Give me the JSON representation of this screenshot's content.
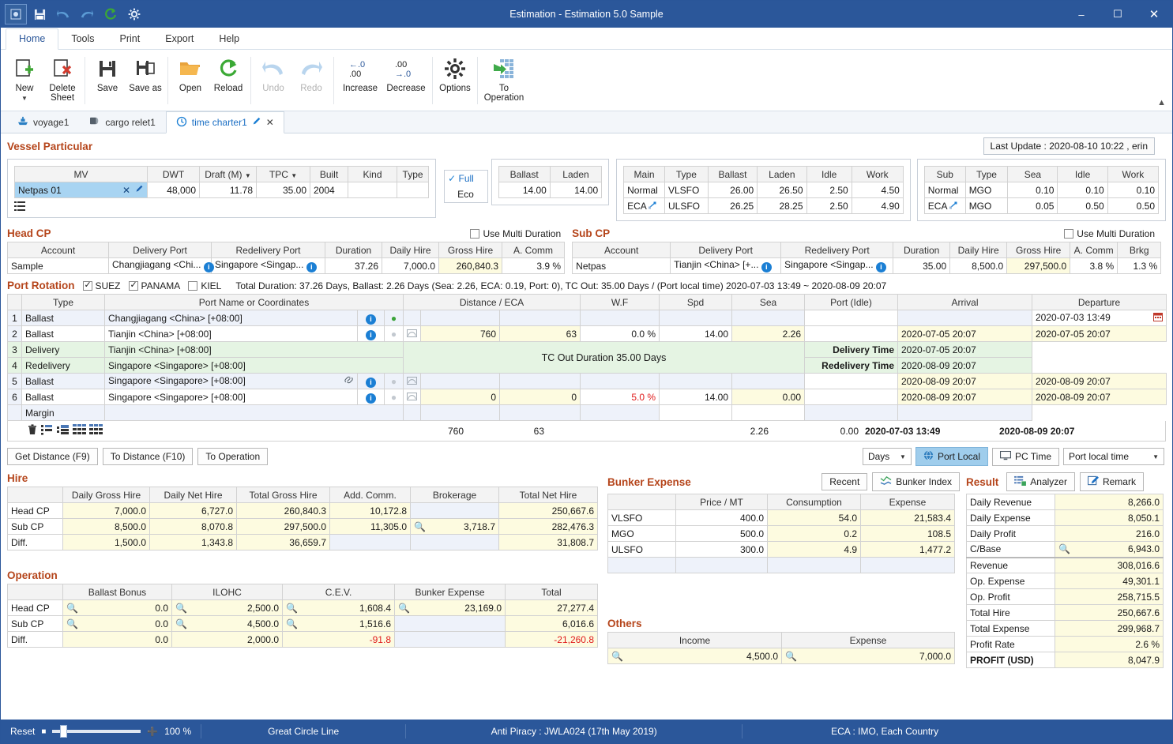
{
  "window": {
    "title": "Estimation - Estimation 5.0 Sample",
    "minimize": "–",
    "maximize": "☐",
    "close": "✕"
  },
  "quick_access": [
    "settings-icon",
    "save-icon",
    "undo-icon",
    "redo-icon",
    "reload-icon",
    "gear-icon"
  ],
  "menu": {
    "tabs": [
      "Home",
      "Tools",
      "Print",
      "Export",
      "Help"
    ],
    "active": "Home"
  },
  "ribbon": {
    "buttons": [
      {
        "label": "New",
        "icon": "new-sheet-icon",
        "has_caret": true,
        "disabled": false
      },
      {
        "label": "Delete Sheet",
        "icon": "delete-sheet-icon",
        "has_caret": false,
        "disabled": false
      },
      {
        "label": "Save",
        "icon": "save-icon",
        "has_caret": false,
        "disabled": false
      },
      {
        "label": "Save as",
        "icon": "save-as-icon",
        "has_caret": false,
        "disabled": false
      },
      {
        "label": "Open",
        "icon": "open-folder-icon",
        "has_caret": false,
        "disabled": false
      },
      {
        "label": "Reload",
        "icon": "reload-icon",
        "has_caret": false,
        "disabled": false
      },
      {
        "label": "Undo",
        "icon": "undo-icon",
        "has_caret": false,
        "disabled": true
      },
      {
        "label": "Redo",
        "icon": "redo-icon",
        "has_caret": false,
        "disabled": true
      },
      {
        "label": "Increase",
        "icon": "increase-decimal-icon",
        "has_caret": false,
        "disabled": false
      },
      {
        "label": "Decrease",
        "icon": "decrease-decimal-icon",
        "has_caret": false,
        "disabled": false
      },
      {
        "label": "Options",
        "icon": "gear-icon",
        "has_caret": false,
        "disabled": false
      },
      {
        "label": "To Operation",
        "icon": "to-operation-icon",
        "has_caret": false,
        "disabled": false
      }
    ]
  },
  "doc_tabs": [
    {
      "label": "voyage1",
      "icon": "ship-icon",
      "active": false
    },
    {
      "label": "cargo relet1",
      "icon": "cargo-icon",
      "active": false
    },
    {
      "label": "time charter1",
      "icon": "clock-icon",
      "active": true
    }
  ],
  "last_update": "Last Update : 2020-08-10 10:22 , erin",
  "vessel_particular": {
    "title": "Vessel Particular",
    "columns": [
      "MV",
      "DWT",
      "Draft (M)",
      "TPC",
      "Built",
      "Kind",
      "Type"
    ],
    "row": {
      "mv": "Netpas 01",
      "dwt": "48,000",
      "draft": "11.78",
      "tpc": "35.00",
      "built": "2004",
      "kind": "",
      "type": ""
    },
    "speed_modes": [
      "Full",
      "Eco"
    ],
    "speed_mode_selected": "Full",
    "speed_columns": [
      "Ballast",
      "Laden"
    ],
    "speed_values": [
      "14.00",
      "14.00"
    ],
    "main_consumption": {
      "columns": [
        "Main",
        "Type",
        "Ballast",
        "Laden",
        "Idle",
        "Work"
      ],
      "rows": [
        {
          "mode": "Normal",
          "type": "VLSFO",
          "ballast": "26.00",
          "laden": "26.50",
          "idle": "2.50",
          "work": "4.50"
        },
        {
          "mode": "ECA",
          "type": "ULSFO",
          "ballast": "26.25",
          "laden": "28.25",
          "idle": "2.50",
          "work": "4.90"
        }
      ]
    },
    "sub_consumption": {
      "columns": [
        "Sub",
        "Type",
        "Sea",
        "Idle",
        "Work"
      ],
      "rows": [
        {
          "mode": "Normal",
          "type": "MGO",
          "sea": "0.10",
          "idle": "0.10",
          "work": "0.10"
        },
        {
          "mode": "ECA",
          "type": "MGO",
          "sea": "0.05",
          "idle": "0.50",
          "work": "0.50"
        }
      ]
    }
  },
  "head_cp": {
    "title": "Head CP",
    "multi_duration_label": "Use Multi Duration",
    "multi_duration_checked": false,
    "columns": [
      "Account",
      "Delivery Port",
      "Redelivery Port",
      "Duration",
      "Daily Hire",
      "Gross Hire",
      "A. Comm"
    ],
    "row": {
      "account": "Sample",
      "delivery_port": "Changjiagang <Chi...",
      "redelivery_port": "Singapore <Singap...",
      "duration": "37.26",
      "daily_hire": "7,000.0",
      "gross_hire": "260,840.3",
      "a_comm": "3.9 %"
    }
  },
  "sub_cp": {
    "title": "Sub CP",
    "multi_duration_label": "Use Multi Duration",
    "multi_duration_checked": false,
    "columns": [
      "Account",
      "Delivery Port",
      "Redelivery Port",
      "Duration",
      "Daily Hire",
      "Gross Hire",
      "A. Comm",
      "Brkg"
    ],
    "row": {
      "account": "Netpas",
      "delivery_port": "Tianjin <China> [+...",
      "redelivery_port": "Singapore <Singap...",
      "duration": "35.00",
      "daily_hire": "8,500.0",
      "gross_hire": "297,500.0",
      "a_comm": "3.8 %",
      "brkg": "1.3 %"
    }
  },
  "port_rotation": {
    "title": "Port Rotation",
    "canals": [
      {
        "label": "SUEZ",
        "checked": true
      },
      {
        "label": "PANAMA",
        "checked": true
      },
      {
        "label": "KIEL",
        "checked": false
      }
    ],
    "summary": "Total Duration: 37.26 Days, Ballast: 2.26 Days (Sea: 2.26, ECA: 0.19, Port: 0), TC Out: 35.00 Days / (Port local time) 2020-07-03 13:49 ~ 2020-08-09 20:07",
    "columns": [
      "",
      "Type",
      "Port Name or Coordinates",
      "Distance / ECA",
      "W.F",
      "Spd",
      "Sea",
      "Port (Idle)",
      "Arrival",
      "Departure"
    ],
    "rows": [
      {
        "no": "1",
        "type": "Ballast",
        "port": "Changjiagang <China> [+08:00]",
        "distance": "",
        "eca": "",
        "wf": "",
        "spd": "",
        "sea": "",
        "idle": "",
        "arrival": "",
        "departure": "2020-07-03 13:49",
        "style": "blu",
        "pin": "on",
        "calendar": true
      },
      {
        "no": "2",
        "type": "Ballast",
        "port": "Tianjin <China> [+08:00]",
        "distance": "760",
        "eca": "63",
        "wf": "0.0 %",
        "spd": "14.00",
        "sea": "2.26",
        "idle": "",
        "arrival": "2020-07-05 20:07",
        "departure": "2020-07-05 20:07",
        "style": "yel",
        "pin": "off",
        "calendar": false
      },
      {
        "no": "5",
        "type": "Ballast",
        "port": "Singapore <Singapore> [+08:00]",
        "distance": "",
        "eca": "",
        "wf": "",
        "spd": "",
        "sea": "",
        "idle": "",
        "arrival": "2020-08-09 20:07",
        "departure": "2020-08-09 20:07",
        "style": "blu",
        "pin": "off",
        "calendar": false,
        "link": true
      },
      {
        "no": "6",
        "type": "Ballast",
        "port": "Singapore <Singapore> [+08:00]",
        "distance": "0",
        "eca": "0",
        "wf": "5.0 %",
        "spd": "14.00",
        "sea": "0.00",
        "idle": "",
        "arrival": "2020-08-09 20:07",
        "departure": "2020-08-09 20:07",
        "style": "yel",
        "pin": "off",
        "calendar": false,
        "wf_red": true
      }
    ],
    "tc_rows": [
      {
        "no": "3",
        "type": "Delivery",
        "port": "Tianjin <China> [+08:00]",
        "time_label": "Delivery Time",
        "time_value": "2020-07-05 20:07"
      },
      {
        "no": "4",
        "type": "Redelivery",
        "port": "Singapore <Singapore> [+08:00]",
        "time_label": "Redelivery Time",
        "time_value": "2020-08-09 20:07"
      }
    ],
    "tc_banner": "TC Out Duration 35.00 Days",
    "margin_label": "Margin",
    "totals": {
      "distance": "760",
      "eca": "63",
      "sea": "2.26",
      "idle": "0.00",
      "arrival": "2020-07-03 13:49",
      "departure": "2020-08-09 20:07"
    },
    "row_tools": [
      "delete-row-icon",
      "insert-row-icon",
      "add-row-icon",
      "split-row-icon",
      "merge-row-icon"
    ]
  },
  "toolbar2": {
    "get_distance": "Get Distance (F9)",
    "to_distance": "To Distance (F10)",
    "to_operation": "To Operation",
    "unit_select": "Days",
    "port_local": "Port Local",
    "pc_time": "PC Time",
    "time_select": "Port local time"
  },
  "hire": {
    "title": "Hire",
    "columns": [
      "",
      "Daily Gross Hire",
      "Daily Net Hire",
      "Total Gross Hire",
      "Add. Comm.",
      "Brokerage",
      "Total Net Hire"
    ],
    "rows": [
      {
        "label": "Head CP",
        "daily_gross": "7,000.0",
        "daily_net": "6,727.0",
        "total_gross": "260,840.3",
        "add_comm": "10,172.8",
        "brokerage": "",
        "total_net": "250,667.6",
        "brokerage_mag": false
      },
      {
        "label": "Sub CP",
        "daily_gross": "8,500.0",
        "daily_net": "8,070.8",
        "total_gross": "297,500.0",
        "add_comm": "11,305.0",
        "brokerage": "3,718.7",
        "total_net": "282,476.3",
        "brokerage_mag": true
      },
      {
        "label": "Diff.",
        "daily_gross": "1,500.0",
        "daily_net": "1,343.8",
        "total_gross": "36,659.7",
        "add_comm": "",
        "brokerage": "",
        "total_net": "31,808.7",
        "brokerage_mag": false
      }
    ]
  },
  "operation": {
    "title": "Operation",
    "columns": [
      "",
      "Ballast Bonus",
      "ILOHC",
      "C.E.V.",
      "Bunker Expense",
      "Total"
    ],
    "rows": [
      {
        "label": "Head CP",
        "ballast_bonus": "0.0",
        "ilohc": "2,500.0",
        "cev": "1,608.4",
        "bunker": "23,169.0",
        "total": "27,277.4",
        "mag": true,
        "bunker_mag": true,
        "cev_red": false,
        "total_red": false
      },
      {
        "label": "Sub CP",
        "ballast_bonus": "0.0",
        "ilohc": "4,500.0",
        "cev": "1,516.6",
        "bunker": "",
        "total": "6,016.6",
        "mag": true,
        "bunker_mag": false,
        "cev_red": false,
        "total_red": false
      },
      {
        "label": "Diff.",
        "ballast_bonus": "0.0",
        "ilohc": "2,000.0",
        "cev": "-91.8",
        "bunker": "",
        "total": "-21,260.8",
        "mag": false,
        "bunker_mag": false,
        "cev_red": true,
        "total_red": true
      }
    ]
  },
  "bunker_expense": {
    "title": "Bunker Expense",
    "recent_button": "Recent",
    "index_button": "Bunker Index",
    "columns": [
      "",
      "Price / MT",
      "Consumption",
      "Expense"
    ],
    "rows": [
      {
        "fuel": "VLSFO",
        "price": "400.0",
        "consumption": "54.0",
        "expense": "21,583.4"
      },
      {
        "fuel": "MGO",
        "price": "500.0",
        "consumption": "0.2",
        "expense": "108.5"
      },
      {
        "fuel": "ULSFO",
        "price": "300.0",
        "consumption": "4.9",
        "expense": "1,477.2"
      },
      {
        "fuel": "",
        "price": "",
        "consumption": "",
        "expense": ""
      }
    ]
  },
  "others": {
    "title": "Others",
    "columns": [
      "Income",
      "Expense"
    ],
    "income": "4,500.0",
    "expense": "7,000.0"
  },
  "result": {
    "title": "Result",
    "analyzer_button": "Analyzer",
    "remark_button": "Remark",
    "rows": [
      {
        "label": "Daily Revenue",
        "value": "8,266.0",
        "mag": false,
        "bold": false
      },
      {
        "label": "Daily Expense",
        "value": "8,050.1",
        "mag": false,
        "bold": false
      },
      {
        "label": "Daily Profit",
        "value": "216.0",
        "mag": false,
        "bold": false
      },
      {
        "label": "C/Base",
        "value": "6,943.0",
        "mag": true,
        "bold": false
      },
      {
        "label": "Revenue",
        "value": "308,016.6",
        "mag": false,
        "bold": false
      },
      {
        "label": "Op. Expense",
        "value": "49,301.1",
        "mag": false,
        "bold": false
      },
      {
        "label": "Op. Profit",
        "value": "258,715.5",
        "mag": false,
        "bold": false
      },
      {
        "label": "Total Hire",
        "value": "250,667.6",
        "mag": false,
        "bold": false
      },
      {
        "label": "Total Expense",
        "value": "299,968.7",
        "mag": false,
        "bold": false
      },
      {
        "label": "Profit Rate",
        "value": "2.6 %",
        "mag": false,
        "bold": false
      },
      {
        "label": "PROFIT (USD)",
        "value": "8,047.9",
        "mag": false,
        "bold": true
      }
    ]
  },
  "statusbar": {
    "reset": "Reset",
    "zoom": "100 %",
    "route": "Great Circle Line",
    "piracy": "Anti Piracy : JWLA024 (17th May 2019)",
    "eca": "ECA : IMO, Each Country"
  }
}
